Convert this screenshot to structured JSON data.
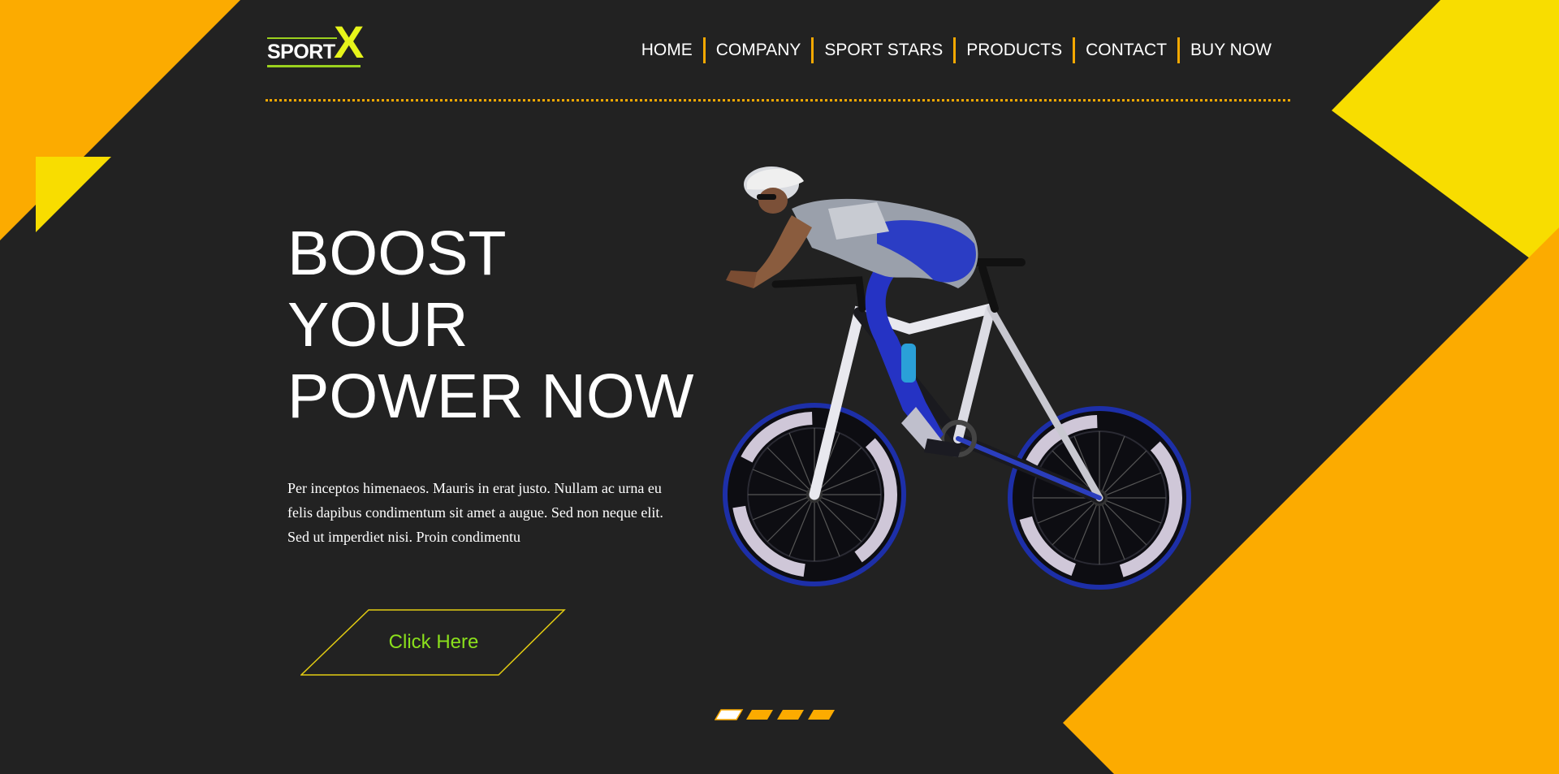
{
  "brand": {
    "logo_text": "SPORT",
    "logo_mark": "X"
  },
  "nav": {
    "items": [
      {
        "label": "HOME"
      },
      {
        "label": "COMPANY"
      },
      {
        "label": "SPORT STARS"
      },
      {
        "label": "PRODUCTS"
      },
      {
        "label": "CONTACT"
      },
      {
        "label": "BUY NOW"
      }
    ]
  },
  "hero": {
    "title_lines": [
      "BOOST",
      "YOUR",
      "POWER NOW"
    ],
    "body": "Per inceptos himenaeos. Mauris in erat justo. Nullam ac urna eu felis dapibus condimentum sit amet a augue. Sed non neque elit. Sed ut imperdiet nisi. Proin condimentu",
    "cta_label": "Click Here",
    "image": "cyclist-on-road-bike"
  },
  "slider": {
    "total": 4,
    "active_index": 0
  },
  "colors": {
    "background": "#222222",
    "accent_orange": "#fcab00",
    "accent_yellow": "#f8dd00",
    "cta_text": "#8be01c",
    "logo_x": "#e7f51a"
  }
}
